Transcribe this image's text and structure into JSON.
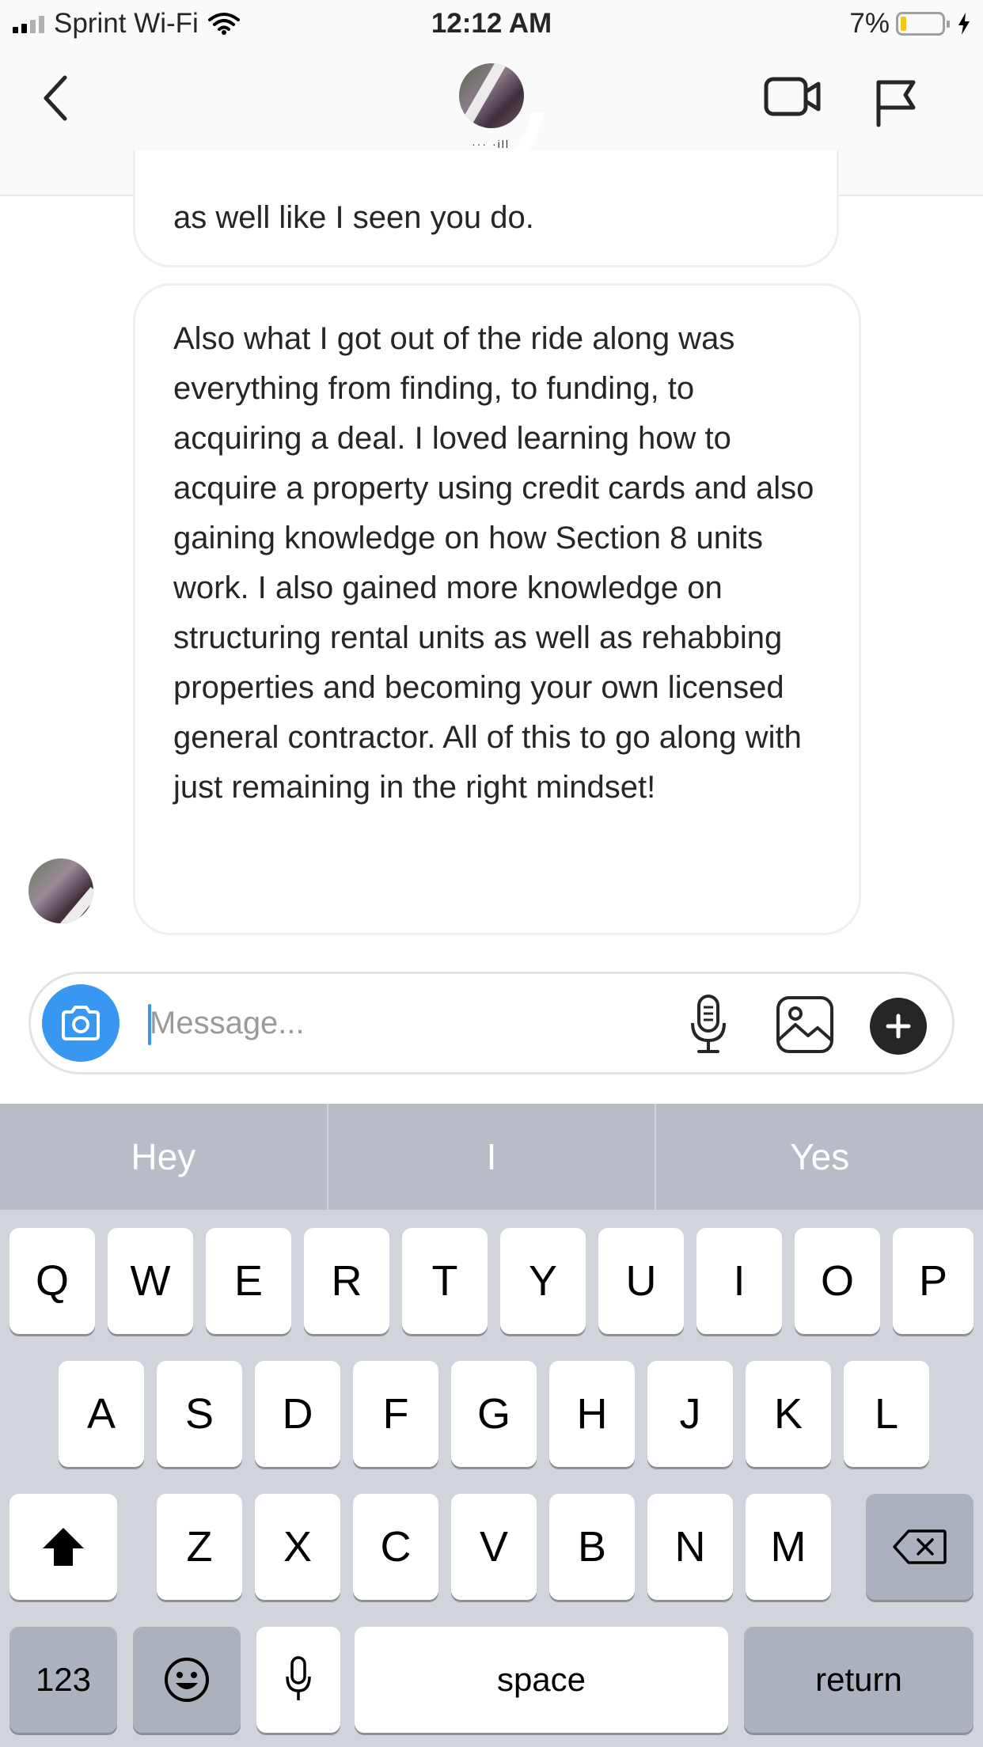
{
  "status_bar": {
    "carrier": "Sprint Wi-Fi",
    "time": "12:12 AM",
    "battery_percent": "7%",
    "battery_level": 0.07
  },
  "header": {
    "username": "··· ·ill"
  },
  "messages": [
    {
      "text": "as well like I seen you do."
    },
    {
      "text": "Also what I got out of the ride along was everything from finding, to funding, to acquiring a deal. I loved learning how to acquire a property using credit cards and also gaining knowledge on how Section 8 units work. I also gained more knowledge on structuring rental units as well as rehabbing properties and becoming your own licensed general contractor. All of this to go along with just remaining in the right mindset!"
    }
  ],
  "composer": {
    "placeholder": "Message..."
  },
  "keyboard": {
    "suggestions": [
      "Hey",
      "I",
      "Yes"
    ],
    "row1": [
      "Q",
      "W",
      "E",
      "R",
      "T",
      "Y",
      "U",
      "I",
      "O",
      "P"
    ],
    "row2": [
      "A",
      "S",
      "D",
      "F",
      "G",
      "H",
      "J",
      "K",
      "L"
    ],
    "row3": [
      "Z",
      "X",
      "C",
      "V",
      "B",
      "N",
      "M"
    ],
    "numbers_label": "123",
    "space_label": "space",
    "return_label": "return"
  },
  "icons": {
    "back": "chevron-left-icon",
    "video": "video-camera-icon",
    "flag": "flag-icon",
    "camera": "camera-icon",
    "mic": "microphone-icon",
    "gallery": "image-icon",
    "plus": "plus-icon",
    "shift": "shift-arrow-icon",
    "delete": "backspace-icon",
    "emoji": "emoji-icon",
    "dictation": "microphone-icon"
  },
  "colors": {
    "accent": "#3897f0",
    "battery_low": "#f5c518"
  }
}
